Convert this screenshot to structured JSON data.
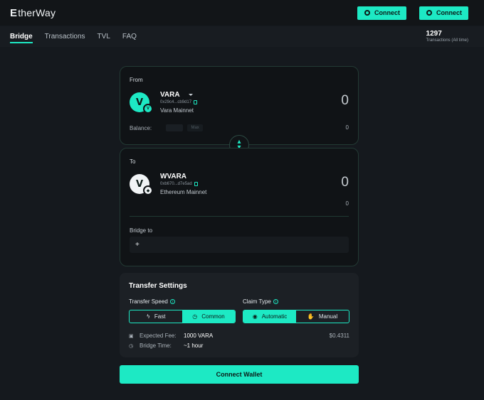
{
  "app": {
    "logo": "therWay",
    "logo_prefix": "E"
  },
  "header": {
    "connect_buttons": [
      {
        "label": "Connect",
        "icon": "vara-wallet-icon"
      },
      {
        "label": "Connect",
        "icon": "eth-wallet-icon"
      }
    ]
  },
  "nav": {
    "items": [
      {
        "label": "Bridge",
        "active": true
      },
      {
        "label": "Transactions",
        "active": false
      },
      {
        "label": "TVL",
        "active": false
      },
      {
        "label": "FAQ",
        "active": false
      }
    ]
  },
  "stats": {
    "count": "1297",
    "label": "Transactions (All time)"
  },
  "from": {
    "label": "From",
    "token": "VARA",
    "address": "0x29c4...cb9d17",
    "network": "Vara Mainnet",
    "amount": "0",
    "balance_label": "Balance:",
    "max_label": "Max",
    "balance_value": "0"
  },
  "to": {
    "label": "To",
    "token": "WVARA",
    "address": "0xb670...d7e5ad",
    "network": "Ethereum Mainnet",
    "amount": "0",
    "sub_amount": "0",
    "bridge_to_label": "Bridge to",
    "bridge_to_value": "+"
  },
  "settings": {
    "title": "Transfer Settings",
    "speed_label": "Transfer Speed",
    "speed_options": [
      {
        "label": "Fast",
        "icon": "lightning-icon",
        "selected": false
      },
      {
        "label": "Common",
        "icon": "clock-icon",
        "selected": true
      }
    ],
    "claim_label": "Claim Type",
    "claim_options": [
      {
        "label": "Automatic",
        "icon": "check-circle-icon",
        "selected": true
      },
      {
        "label": "Manual",
        "icon": "hand-icon",
        "selected": false
      }
    ],
    "fee_label": "Expected Fee:",
    "fee_value": "1000 VARA",
    "fee_usd": "$0.4311",
    "time_label": "Bridge Time:",
    "time_value": "~1 hour"
  },
  "cta": {
    "label": "Connect Wallet"
  },
  "colors": {
    "accent": "#1de9c4",
    "background": "#15191e"
  }
}
